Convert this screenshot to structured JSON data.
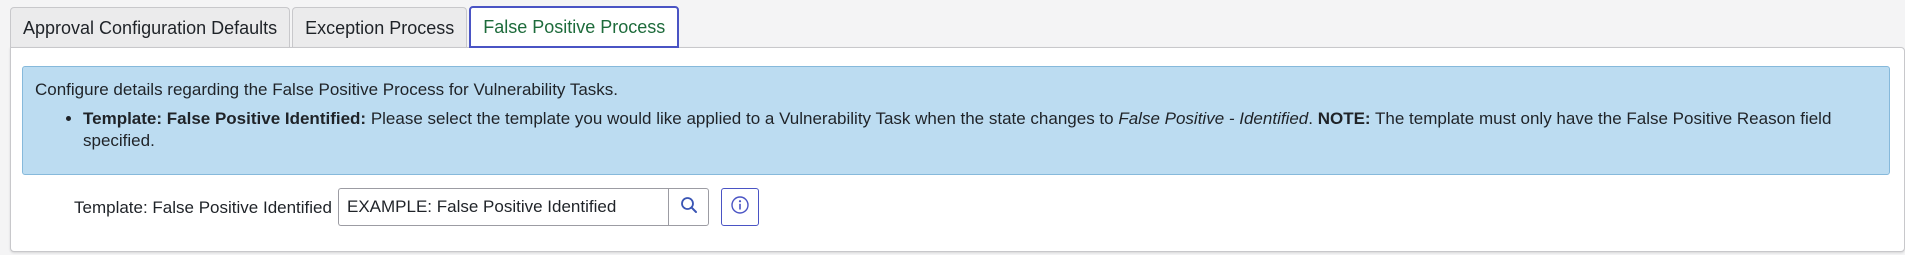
{
  "tabs": [
    {
      "label": "Approval Configuration Defaults",
      "active": false
    },
    {
      "label": "Exception Process",
      "active": false
    },
    {
      "label": "False Positive Process",
      "active": true
    }
  ],
  "info": {
    "intro": "Configure details regarding the False Positive Process for Vulnerability Tasks.",
    "item": {
      "bold_label": "Template: False Positive Identified:",
      "text_before": " Please select the template you would like applied to a Vulnerability Task when the state changes to ",
      "italic_state": "False Positive - Identified",
      "text_after_state": ". ",
      "note_label": "NOTE:",
      "note_text": " The template must only have the False Positive Reason field specified."
    }
  },
  "field": {
    "label": "Template: False Positive Identified",
    "value": "EXAMPLE: False Positive Identified",
    "search_icon": "search-icon",
    "info_icon": "info-icon"
  },
  "colors": {
    "active_tab_border": "#4a54c4",
    "active_tab_text": "#1d6b3b",
    "info_background": "#bcdcf1",
    "info_border": "#86b9db"
  }
}
